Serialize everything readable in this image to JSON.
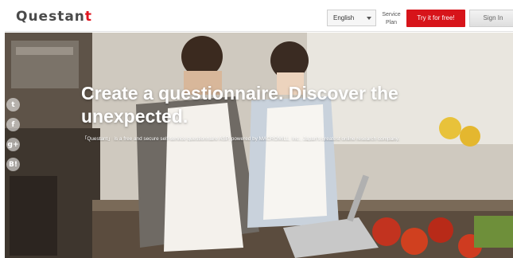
{
  "header": {
    "logo_text": "Questan",
    "logo_dot": "t",
    "language": "English",
    "service_plan_line1": "Service",
    "service_plan_line2": "Plan",
    "try_button": "Try it for free!",
    "signin_button": "Sign In"
  },
  "hero": {
    "title": "Create a questionnaire. Discover the unexpected.",
    "subtitle": "「Questant」 is a free and secure self-service questionnaire ASP, powered by MACROMILL, Inc., Japan's greatest online research company."
  },
  "social": {
    "icons": [
      "twitter-icon",
      "facebook-icon",
      "google-plus-icon",
      "hatena-bookmark-icon"
    ],
    "glyphs": [
      "t",
      "f",
      "g+",
      "B!"
    ]
  },
  "colors": {
    "accent": "#d7141a",
    "logo": "#4a4a4a"
  }
}
